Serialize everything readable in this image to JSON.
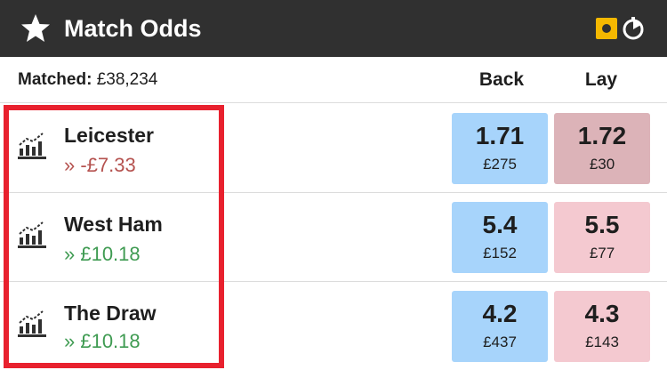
{
  "header": {
    "title": "Match Odds",
    "icons": [
      "star-icon",
      "live-icon",
      "timer-icon"
    ],
    "bg_color": "#303030",
    "accent_color": "#f5b800"
  },
  "market": {
    "matched_label": "Matched:",
    "matched_value": "£38,234",
    "back_label": "Back",
    "lay_label": "Lay"
  },
  "runners": [
    {
      "name": "Leicester",
      "pnl": "» -£7.33",
      "pnl_sign": "negative",
      "back": {
        "price": "1.71",
        "stake": "£275"
      },
      "lay": {
        "price": "1.72",
        "stake": "£30"
      }
    },
    {
      "name": "West Ham",
      "pnl": "» £10.18",
      "pnl_sign": "positive",
      "back": {
        "price": "5.4",
        "stake": "£152"
      },
      "lay": {
        "price": "5.5",
        "stake": "£77"
      }
    },
    {
      "name": "The Draw",
      "pnl": "» £10.18",
      "pnl_sign": "positive",
      "back": {
        "price": "4.2",
        "stake": "£437"
      },
      "lay": {
        "price": "4.3",
        "stake": "£143"
      }
    }
  ],
  "colors": {
    "back": "#a7d4fb",
    "lay": "#f4c9d0",
    "lay_selected": "#dcb3b8",
    "pnl_negative": "#b5524f",
    "pnl_positive": "#3f9b52",
    "highlight": "#e8212e"
  }
}
